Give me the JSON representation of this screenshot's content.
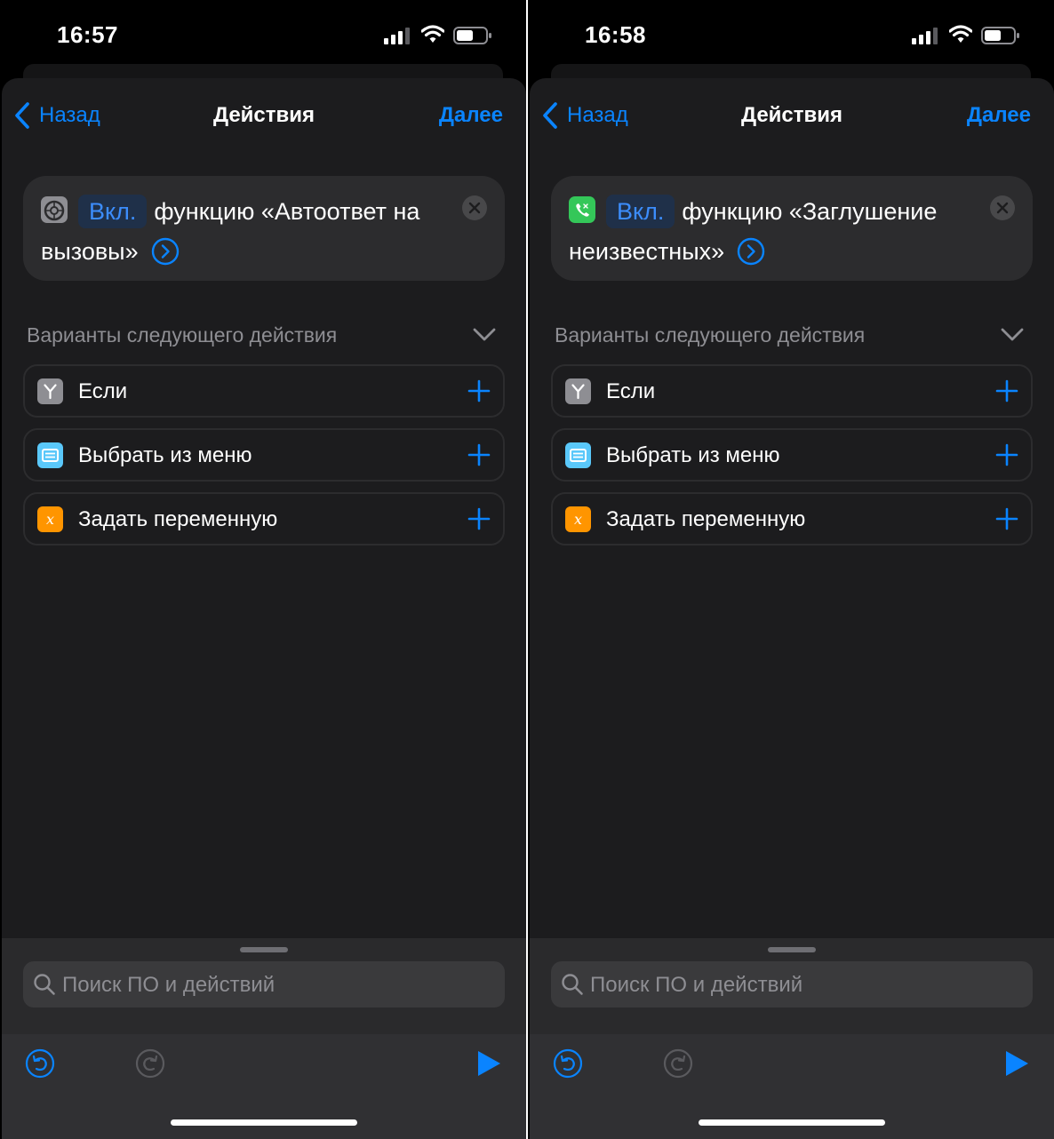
{
  "colors": {
    "accent": "#0a84ff",
    "sheet_background": "#1c1c1e",
    "card_background": "#2c2c2e",
    "icon_if": "#8e8e93",
    "icon_menu": "#5ac8fa",
    "icon_variable": "#ff9500",
    "icon_settings": "#8e8e93",
    "icon_phone": "#34c759"
  },
  "left": {
    "status": {
      "time": "16:57"
    },
    "nav": {
      "back_label": "Назад",
      "title": "Действия",
      "next_label": "Далее"
    },
    "action": {
      "app_icon": "settings-icon",
      "toggle": "Вкл.",
      "text": "функцию «Автоответ на вызовы»"
    },
    "suggestions": {
      "header": "Варианты следующего действия",
      "items": [
        {
          "label": "Если",
          "icon": "if-icon"
        },
        {
          "label": "Выбрать из меню",
          "icon": "menu-icon"
        },
        {
          "label": "Задать переменную",
          "icon": "variable-icon"
        }
      ]
    },
    "search": {
      "placeholder": "Поиск ПО и действий"
    }
  },
  "right": {
    "status": {
      "time": "16:58"
    },
    "nav": {
      "back_label": "Назад",
      "title": "Действия",
      "next_label": "Далее"
    },
    "action": {
      "app_icon": "phone-icon",
      "toggle": "Вкл.",
      "text": "функцию «Заглушение неизвестных»"
    },
    "suggestions": {
      "header": "Варианты следующего действия",
      "items": [
        {
          "label": "Если",
          "icon": "if-icon"
        },
        {
          "label": "Выбрать из меню",
          "icon": "menu-icon"
        },
        {
          "label": "Задать переменную",
          "icon": "variable-icon"
        }
      ]
    },
    "search": {
      "placeholder": "Поиск ПО и действий"
    }
  }
}
